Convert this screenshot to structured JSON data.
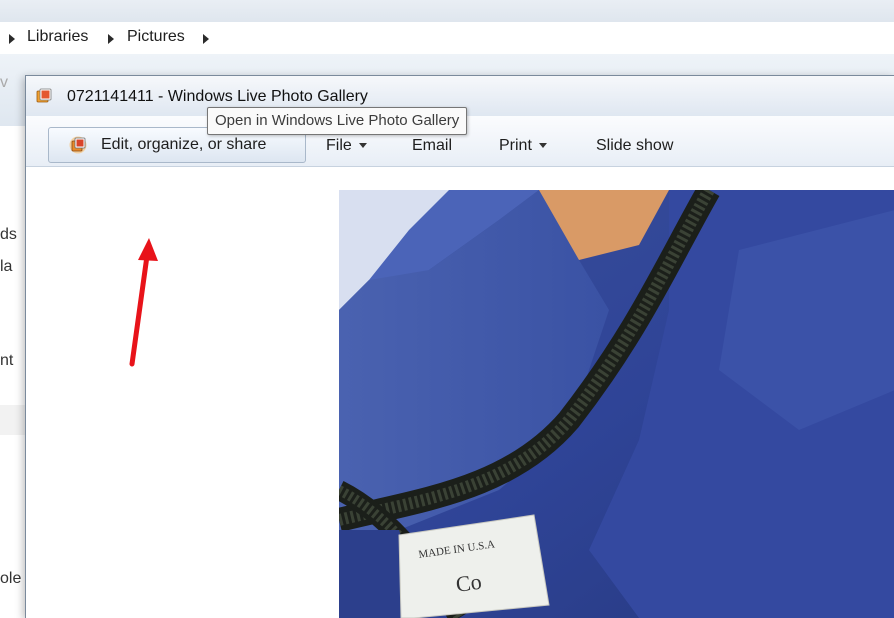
{
  "background_window": {
    "breadcrumb": [
      "Libraries",
      "Pictures"
    ],
    "left_fragments": [
      "ds",
      "la",
      "nt",
      "ole"
    ],
    "strip_fragment": "v"
  },
  "window": {
    "title": "0721141411 - Windows Live Photo Gallery",
    "app_icon": "photo-gallery-icon"
  },
  "toolbar": {
    "edit_label": "Edit, organize, or share",
    "file_label": "File",
    "email_label": "Email",
    "print_label": "Print",
    "slideshow_label": "Slide show"
  },
  "tooltip": {
    "text": "Open in Windows Live Photo Gallery"
  },
  "photo": {
    "label_text_1": "MADE IN U.S.A",
    "label_text_2": "Co"
  },
  "annotation": {
    "arrow_color": "#e8131a"
  }
}
